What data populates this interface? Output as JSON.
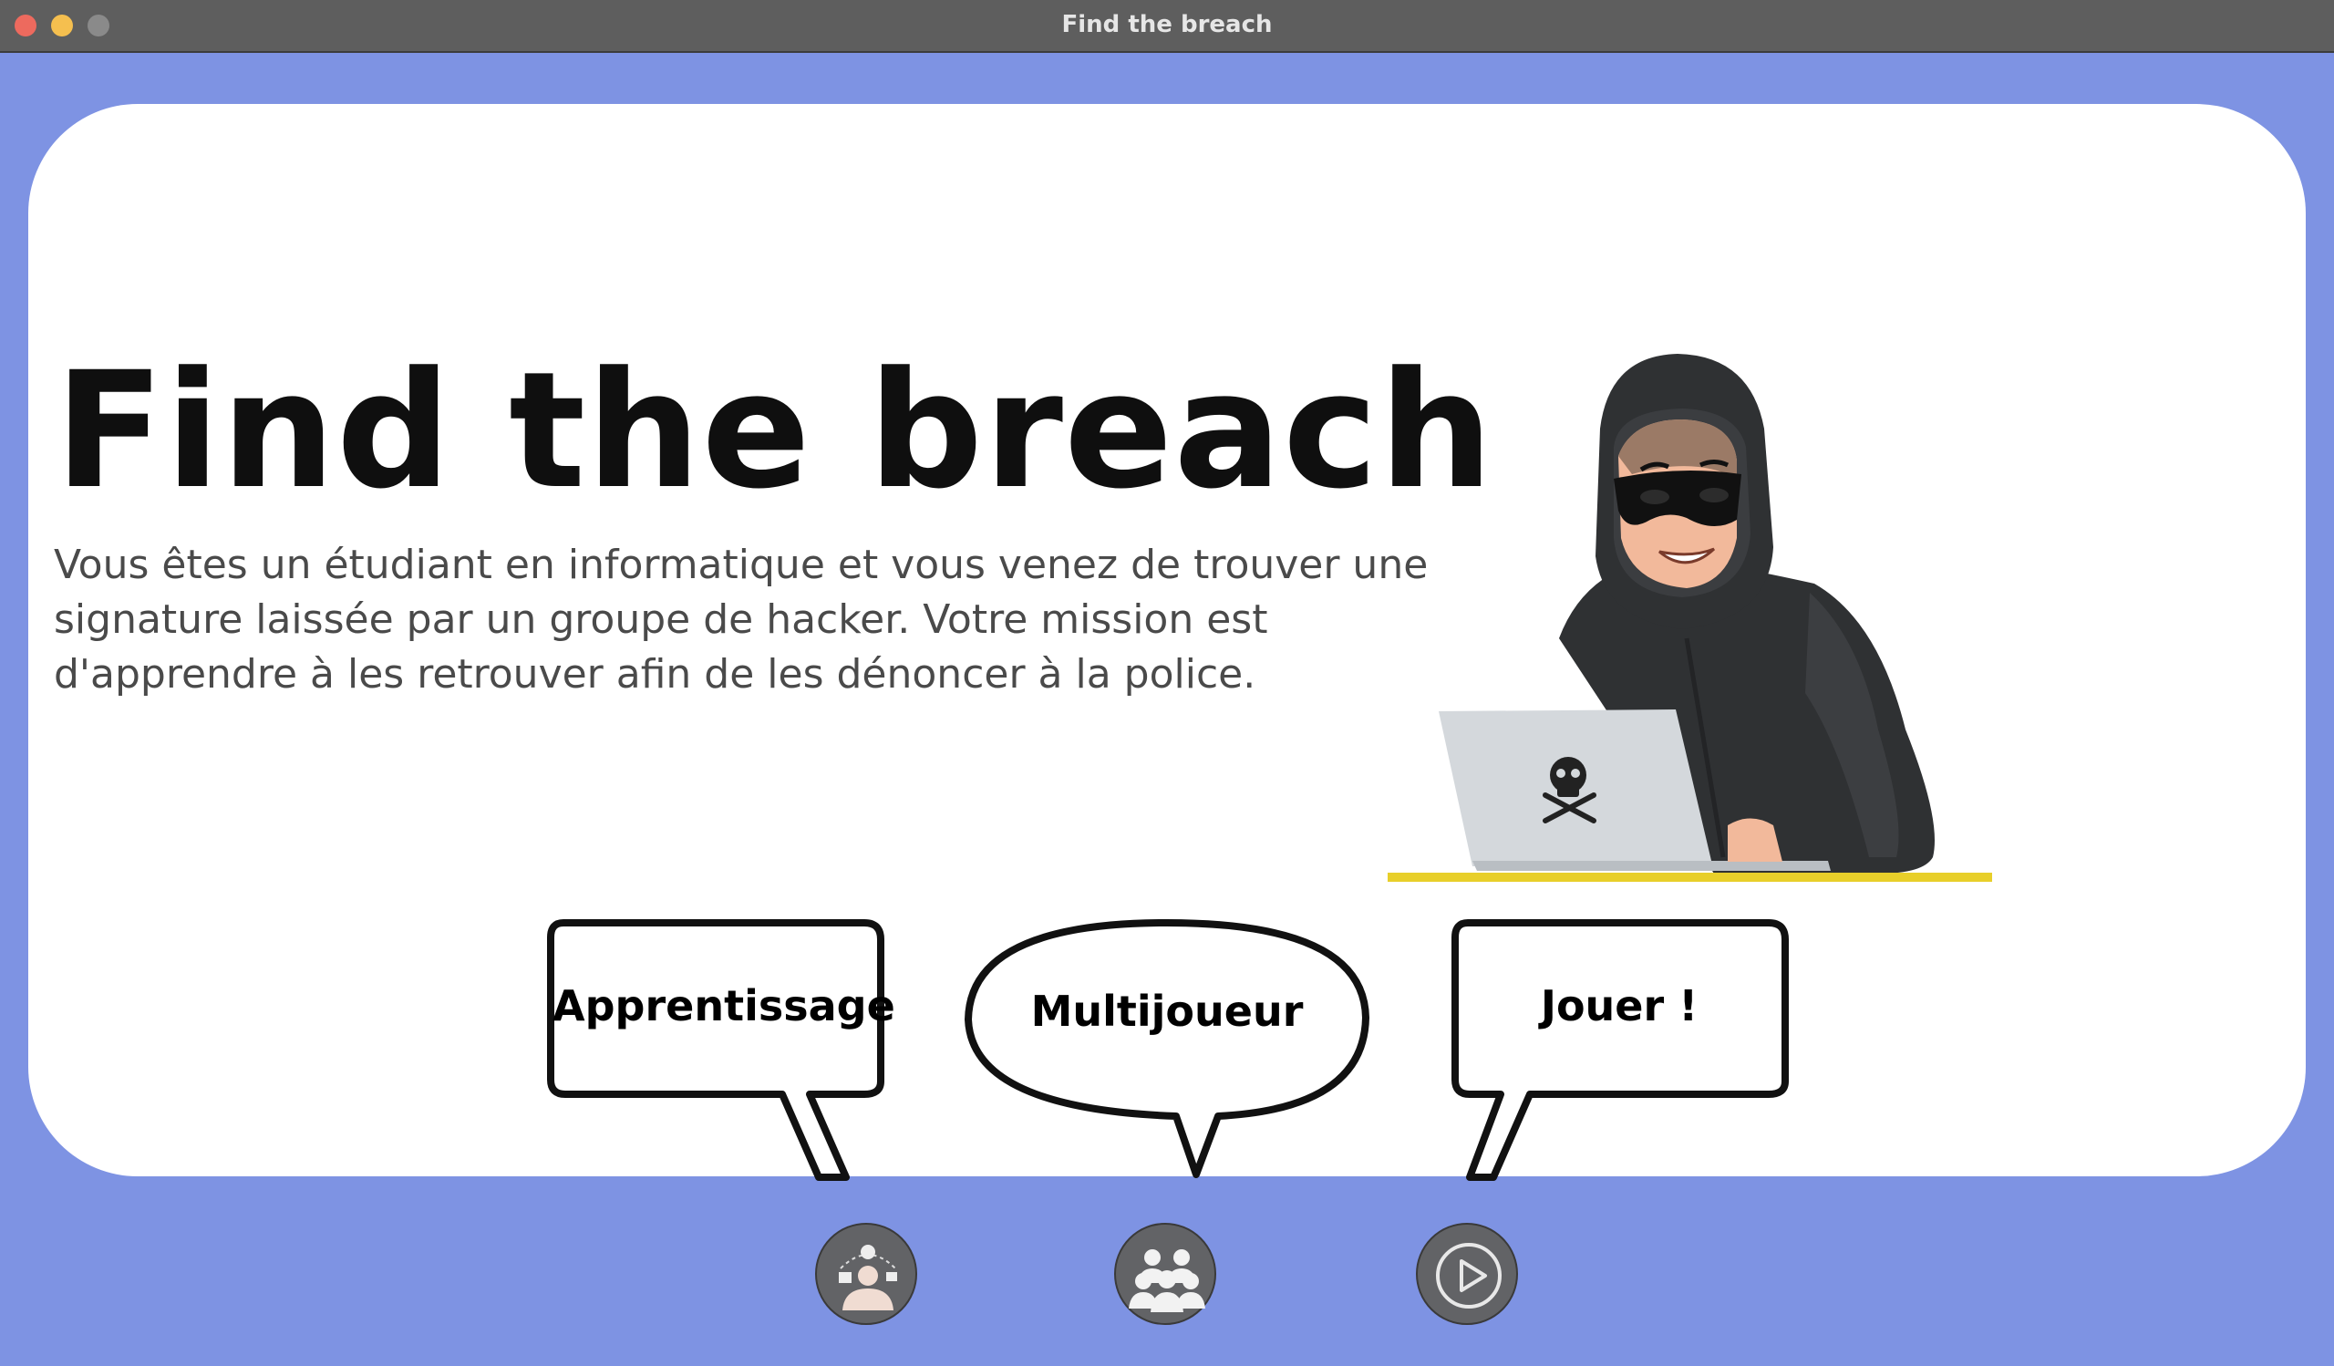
{
  "window": {
    "title": "Find the breach"
  },
  "hero": {
    "title": "Find the breach",
    "description": "Vous êtes un étudiant en informatique et vous venez de trouver une signature laissée par un groupe de hacker. Votre mission est d'apprendre à les retrouver afin de les dénoncer à la police."
  },
  "modes": [
    {
      "label": "Apprentissage",
      "icon": "learning-icon"
    },
    {
      "label": "Multijoueur",
      "icon": "group-icon"
    },
    {
      "label": "Jouer !",
      "icon": "play-icon"
    }
  ],
  "colors": {
    "background": "#7e93e3",
    "card": "#ffffff",
    "button": "#626366",
    "desk": "#e8cf2a"
  }
}
